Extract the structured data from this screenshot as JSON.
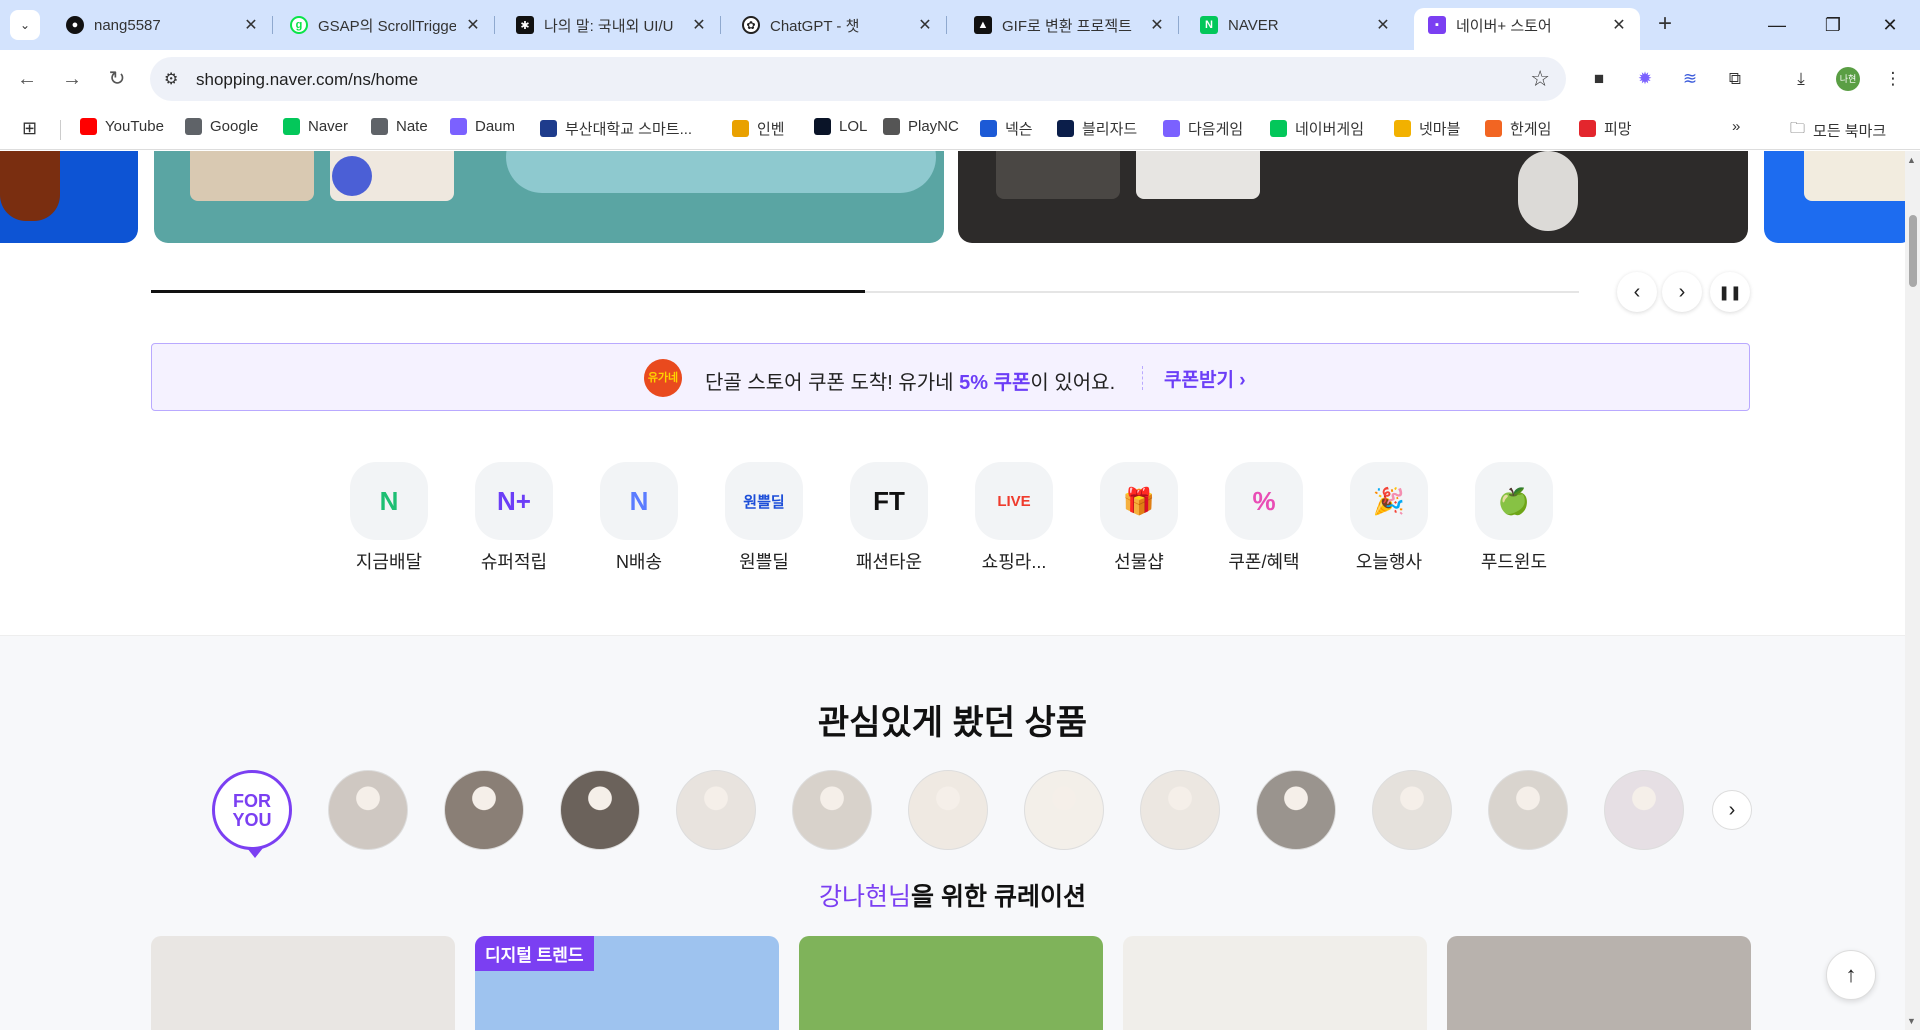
{
  "browser": {
    "tabs": [
      {
        "title": "nang5587",
        "icon": "github-icon"
      },
      {
        "title": "GSAP의 ScrollTrigger",
        "icon": "gsap-icon"
      },
      {
        "title": "나의 말: 국내외 UI/U",
        "icon": "notion-icon"
      },
      {
        "title": "ChatGPT - 챗",
        "icon": "openai-icon"
      },
      {
        "title": "GIF로 변환 프로젝트",
        "icon": "ai-icon"
      },
      {
        "title": "NAVER",
        "icon": "naver-icon"
      },
      {
        "title": "네이버+ 스토어",
        "icon": "naver-store-icon"
      }
    ],
    "new_tab": "+",
    "url": "shopping.naver.com/ns/home",
    "profile_initial": "나현",
    "bookmarks": [
      {
        "label": "YouTube",
        "color": "#ff0000"
      },
      {
        "label": "Google",
        "color": "#5f6368"
      },
      {
        "label": "Naver",
        "color": "#03c75a"
      },
      {
        "label": "Nate",
        "color": "#5f6368"
      },
      {
        "label": "Daum",
        "color": "#7b61ff"
      },
      {
        "label": "부산대학교 스마트...",
        "color": "#1e3c8c"
      },
      {
        "label": "인벤",
        "color": "#e9a100"
      },
      {
        "label": "LOL",
        "color": "#0a1428"
      },
      {
        "label": "PlayNC",
        "color": "#555555"
      },
      {
        "label": "넥슨",
        "color": "#1c5ad6"
      },
      {
        "label": "블리자드",
        "color": "#0b1e4a"
      },
      {
        "label": "다음게임",
        "color": "#7b61ff"
      },
      {
        "label": "네이버게임",
        "color": "#03c75a"
      },
      {
        "label": "넷마블",
        "color": "#f2b100"
      },
      {
        "label": "한게임",
        "color": "#f26522"
      },
      {
        "label": "피망",
        "color": "#e3262d"
      }
    ],
    "bookmarks_overflow": "»",
    "all_bookmarks": "모든 북마크"
  },
  "page": {
    "slider": {
      "progress": 0.5,
      "prev": "‹",
      "next": "›",
      "pause": "❚❚"
    },
    "coupon": {
      "logo_text": "유가네",
      "text_prefix": "단골 스토어 쿠폰 도착! 유가네 ",
      "highlight": "5% 쿠폰",
      "text_suffix": "이 있어요.",
      "cta": "쿠폰받기",
      "cta_arrow": "›"
    },
    "shortcuts": [
      {
        "label": "지금배달",
        "icon": "quick-delivery-icon",
        "glyph": "N",
        "color": "#1dbf73"
      },
      {
        "label": "슈퍼적립",
        "icon": "super-points-icon",
        "glyph": "N+",
        "color": "#6c3ef7"
      },
      {
        "label": "N배송",
        "icon": "n-delivery-icon",
        "glyph": "N",
        "color": "#5b7cff"
      },
      {
        "label": "원쁠딜",
        "icon": "one-plus-deal-icon",
        "glyph": "원쁠딜",
        "color": "#1d4ed8"
      },
      {
        "label": "패션타운",
        "icon": "fashion-town-icon",
        "glyph": "FT",
        "color": "#111111"
      },
      {
        "label": "쇼핑라...",
        "icon": "shopping-live-icon",
        "glyph": "LIVE",
        "color": "#ef3b2d"
      },
      {
        "label": "선물샵",
        "icon": "gift-shop-icon",
        "glyph": "🎁",
        "color": "#19b37a"
      },
      {
        "label": "쿠폰/혜택",
        "icon": "coupon-icon",
        "glyph": "%",
        "color": "#e94db5"
      },
      {
        "label": "오늘행사",
        "icon": "party-icon",
        "glyph": "🎉",
        "color": "#3d7bff"
      },
      {
        "label": "푸드윈도",
        "icon": "apple-icon",
        "glyph": "🍏",
        "color": "#2fb82f"
      }
    ],
    "viewed_title": "관심있게 봤던 상품",
    "for_you": "FOR YOU",
    "viewed_colors": [
      "#cfc8c2",
      "#8a7f76",
      "#6b625b",
      "#e8e3de",
      "#d8d2cb",
      "#efe9e2",
      "#f3efe9",
      "#ece7e1",
      "#9a948e",
      "#e5e1dc",
      "#d9d4ce",
      "#e6dfe4"
    ],
    "curation_name": "강나현님",
    "curation_suffix": "을 위한 큐레이션",
    "cards": [
      {
        "badge": "",
        "color": "#e9e6e3"
      },
      {
        "badge": "디지털 트렌드",
        "color": "#9ec3ef"
      },
      {
        "badge": "",
        "color": "#7fb35a"
      },
      {
        "badge": "",
        "color": "#f0eeea"
      },
      {
        "badge": "",
        "color": "#b8b2ad"
      }
    ],
    "to_top": "↑"
  }
}
